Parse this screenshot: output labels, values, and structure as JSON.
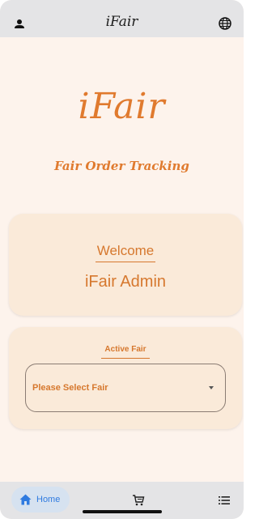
{
  "appbar": {
    "title": "iFair",
    "left_icon": "person-icon",
    "right_icon": "globe-icon"
  },
  "brand": {
    "logo_text": "iFair",
    "tagline": "Fair Order Tracking"
  },
  "welcome_card": {
    "label": "Welcome",
    "user_name": "iFair Admin"
  },
  "fair_card": {
    "label": "Active Fair",
    "select_value": "Please Select Fair"
  },
  "bottom_nav": {
    "home_label": "Home",
    "home_icon": "home-icon",
    "cart_icon": "cart-icon",
    "list_icon": "list-icon"
  },
  "colors": {
    "accent": "#e07a2e",
    "background": "#fdf3ec",
    "card": "#faead9",
    "bar": "#e4e4e6",
    "nav_active": "#2f7be0"
  }
}
